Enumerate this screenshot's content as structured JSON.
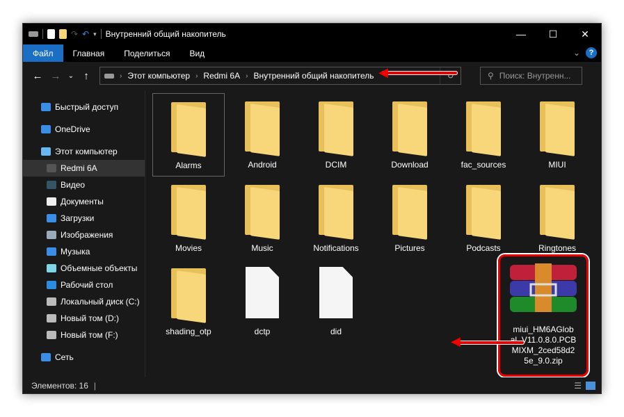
{
  "window": {
    "title": "Внутренний общий накопитель",
    "controls": {
      "minimize": "—",
      "maximize": "☐",
      "close": "✕"
    }
  },
  "ribbon": {
    "tabs": [
      "Файл",
      "Главная",
      "Поделиться",
      "Вид"
    ],
    "accent": "#1a6fc4",
    "help": "?"
  },
  "address": {
    "crumbs": [
      "Этот компьютер",
      "Redmi 6A",
      "Внутренний общий накопитель"
    ]
  },
  "search": {
    "placeholder": "Поиск: Внутренн..."
  },
  "sidebar": {
    "items": [
      {
        "label": "Быстрый доступ",
        "icon": "star-icon",
        "level": 0
      },
      {
        "label": "OneDrive",
        "icon": "cloud-icon",
        "level": 0
      },
      {
        "label": "Этот компьютер",
        "icon": "computer-icon",
        "level": 0
      },
      {
        "label": "Redmi 6A",
        "icon": "phone-icon",
        "level": 1,
        "selected": true
      },
      {
        "label": "Видео",
        "icon": "video-icon",
        "level": 1
      },
      {
        "label": "Документы",
        "icon": "document-icon",
        "level": 1
      },
      {
        "label": "Загрузки",
        "icon": "download-icon",
        "level": 1
      },
      {
        "label": "Изображения",
        "icon": "image-icon",
        "level": 1
      },
      {
        "label": "Музыка",
        "icon": "music-icon",
        "level": 1
      },
      {
        "label": "Объемные объекты",
        "icon": "cube-icon",
        "level": 1
      },
      {
        "label": "Рабочий стол",
        "icon": "desktop-icon",
        "level": 1
      },
      {
        "label": "Локальный диск (C:)",
        "icon": "drive-icon",
        "level": 1
      },
      {
        "label": "Новый том (D:)",
        "icon": "drive-icon",
        "level": 1
      },
      {
        "label": "Новый том (F:)",
        "icon": "drive-icon",
        "level": 1
      },
      {
        "label": "Сеть",
        "icon": "network-icon",
        "level": 0
      }
    ]
  },
  "files": [
    {
      "name": "Alarms",
      "type": "folder",
      "selected": true
    },
    {
      "name": "Android",
      "type": "folder"
    },
    {
      "name": "DCIM",
      "type": "folder"
    },
    {
      "name": "Download",
      "type": "folder"
    },
    {
      "name": "fac_sources",
      "type": "folder"
    },
    {
      "name": "MIUI",
      "type": "folder"
    },
    {
      "name": "Movies",
      "type": "folder"
    },
    {
      "name": "Music",
      "type": "folder"
    },
    {
      "name": "Notifications",
      "type": "folder"
    },
    {
      "name": "Pictures",
      "type": "folder"
    },
    {
      "name": "Podcasts",
      "type": "folder"
    },
    {
      "name": "Ringtones",
      "type": "folder"
    },
    {
      "name": "shading_otp",
      "type": "folder"
    },
    {
      "name": "dctp",
      "type": "file"
    },
    {
      "name": "did",
      "type": "file"
    }
  ],
  "zip": {
    "name": "miui_HM6AGlobal_V11.0.8.0.PCBMIXM_2ced58d25e_9.0.zip",
    "lines": [
      "miui_HM6AGlob",
      "al_V11.0.8.0.PCB",
      "MIXM_2ced58d2",
      "5e_9.0.zip"
    ]
  },
  "status": {
    "count": "Элементов: 16"
  },
  "annotation_color": "#e00000"
}
